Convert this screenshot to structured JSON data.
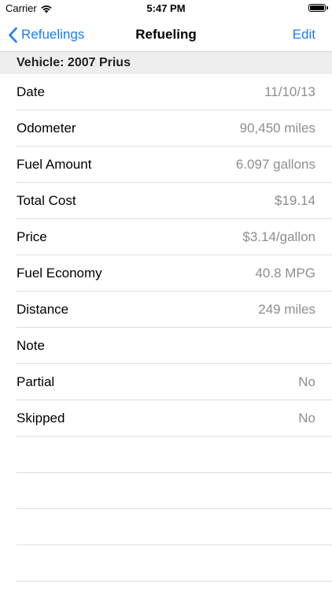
{
  "status_bar": {
    "carrier": "Carrier",
    "time": "5:47 PM"
  },
  "nav": {
    "back_label": "Refuelings",
    "title": "Refueling",
    "edit_label": "Edit"
  },
  "section": {
    "header": "Vehicle: 2007 Prius"
  },
  "rows": [
    {
      "label": "Date",
      "value": "11/10/13"
    },
    {
      "label": "Odometer",
      "value": "90,450 miles"
    },
    {
      "label": "Fuel Amount",
      "value": "6.097 gallons"
    },
    {
      "label": "Total Cost",
      "value": "$19.14"
    },
    {
      "label": "Price",
      "value": "$3.14/gallon"
    },
    {
      "label": "Fuel Economy",
      "value": "40.8 MPG"
    },
    {
      "label": "Distance",
      "value": "249 miles"
    },
    {
      "label": "Note",
      "value": ""
    },
    {
      "label": "Partial",
      "value": "No"
    },
    {
      "label": "Skipped",
      "value": "No"
    }
  ],
  "colors": {
    "accent": "#1a7cf5",
    "secondary_text": "#8e8e93",
    "section_background": "#eeeef0"
  }
}
